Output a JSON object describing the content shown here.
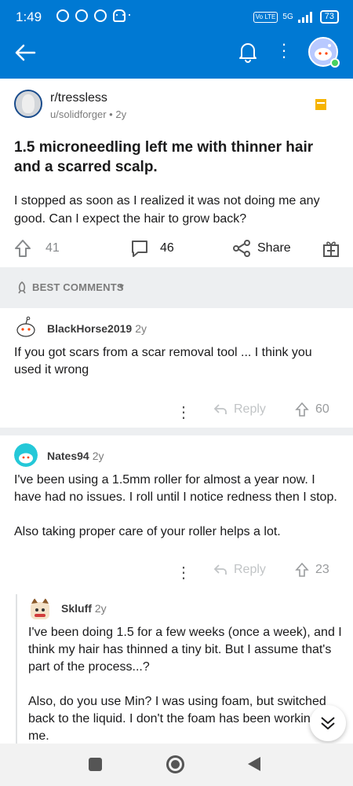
{
  "status_bar": {
    "time": "1:49",
    "network": "5G",
    "volte": "Vo LTE",
    "battery": "73"
  },
  "colors": {
    "brand": "#0079d3",
    "sort_bar": "#edeff1",
    "save_badge": "#f6b400",
    "online": "#46d160"
  },
  "post": {
    "subreddit": "r/tressless",
    "author": "u/solidforger",
    "age": "2y",
    "title": "1.5 microneedling left me with thinner hair and a scarred scalp.",
    "body": "I stopped as soon as I realized it was not doing me any good. Can I expect the hair to grow back?",
    "upvotes": "41",
    "comments": "46",
    "share_label": "Share"
  },
  "sort": {
    "label": "BEST COMMENTS"
  },
  "comments": [
    {
      "author": "BlackHorse2019",
      "age": "2y",
      "body": "If you got scars from a scar removal tool ... I think you used it wrong",
      "reply_label": "Reply",
      "votes": "60"
    },
    {
      "author": "Nates94",
      "age": "2y",
      "body_p1": "I've been using a 1.5mm roller for almost a year now. I have had no issues. I roll until I notice redness then I stop.",
      "body_p2": "Also taking proper care of your roller helps a lot.",
      "reply_label": "Reply",
      "votes": "23"
    },
    {
      "author": "Skluff",
      "age": "2y",
      "body_p1": "I've been doing 1.5 for a few weeks (once a week), and I think my hair has thinned a tiny bit. But I assume that's part of the process...?",
      "body_p2": "Also, do you use Min? I was using foam, but switched back to the liquid. I don't the foam has been workin... for me."
    }
  ]
}
